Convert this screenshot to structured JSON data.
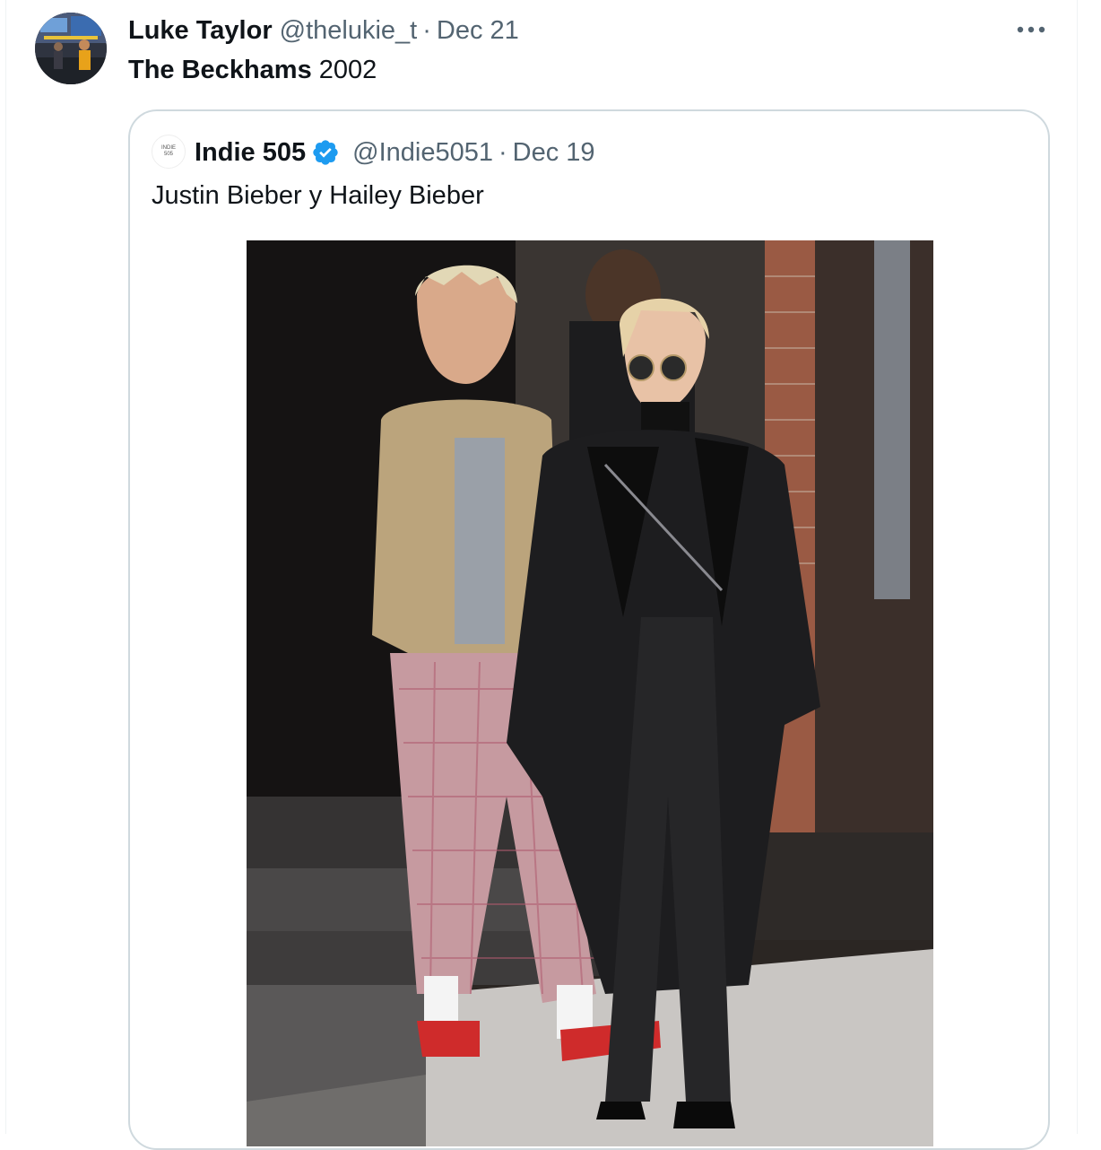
{
  "tweet": {
    "author_name": "Luke Taylor",
    "handle": "@thelukie_t",
    "separator": "·",
    "date": "Dec 21",
    "text_bold": "The Beckhams",
    "text_rest": " 2002",
    "more_icon": "more-horizontal-icon"
  },
  "quote": {
    "avatar_text_line1": "INDIE",
    "avatar_text_line2": "505",
    "author_name": "Indie 505",
    "verified_icon": "verified-badge-icon",
    "verified_color": "#1d9bf0",
    "handle": "@Indie5051",
    "separator": "·",
    "date": "Dec 19",
    "text": "Justin Bieber y Hailey Bieber"
  },
  "colors": {
    "text_primary": "#0f1419",
    "text_secondary": "#536471",
    "border": "#cfd9de"
  }
}
